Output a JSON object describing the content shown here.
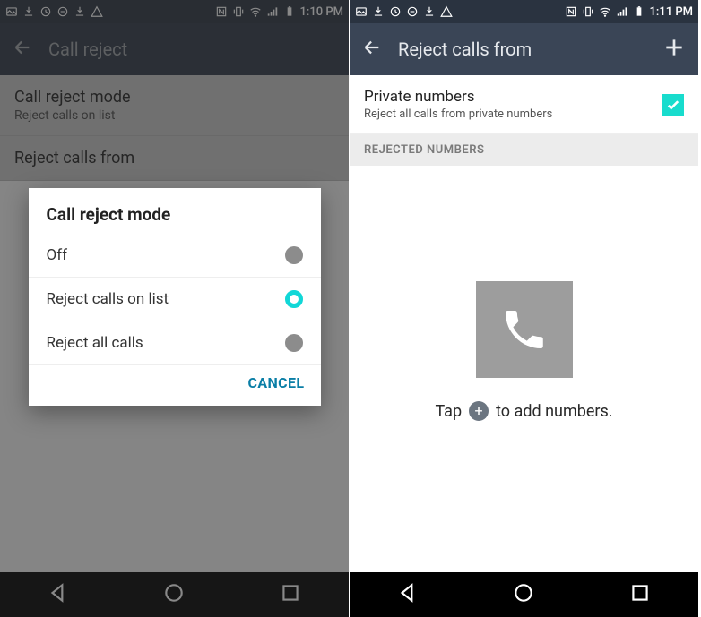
{
  "left": {
    "status": {
      "time": "1:10 PM"
    },
    "appbar": {
      "title": "Call reject"
    },
    "items": [
      {
        "primary": "Call reject mode",
        "secondary": "Reject calls on list"
      },
      {
        "primary": "Reject calls from"
      }
    ],
    "dialog": {
      "title": "Call reject mode",
      "options": [
        {
          "label": "Off",
          "selected": false
        },
        {
          "label": "Reject calls on list",
          "selected": true
        },
        {
          "label": "Reject all calls",
          "selected": false
        }
      ],
      "cancel": "CANCEL"
    }
  },
  "right": {
    "status": {
      "time": "1:11 PM"
    },
    "appbar": {
      "title": "Reject calls from"
    },
    "setting": {
      "primary": "Private numbers",
      "secondary": "Reject all calls from private numbers",
      "checked": true
    },
    "section": "REJECTED NUMBERS",
    "hint_pre": "Tap",
    "hint_post": "to add numbers."
  }
}
